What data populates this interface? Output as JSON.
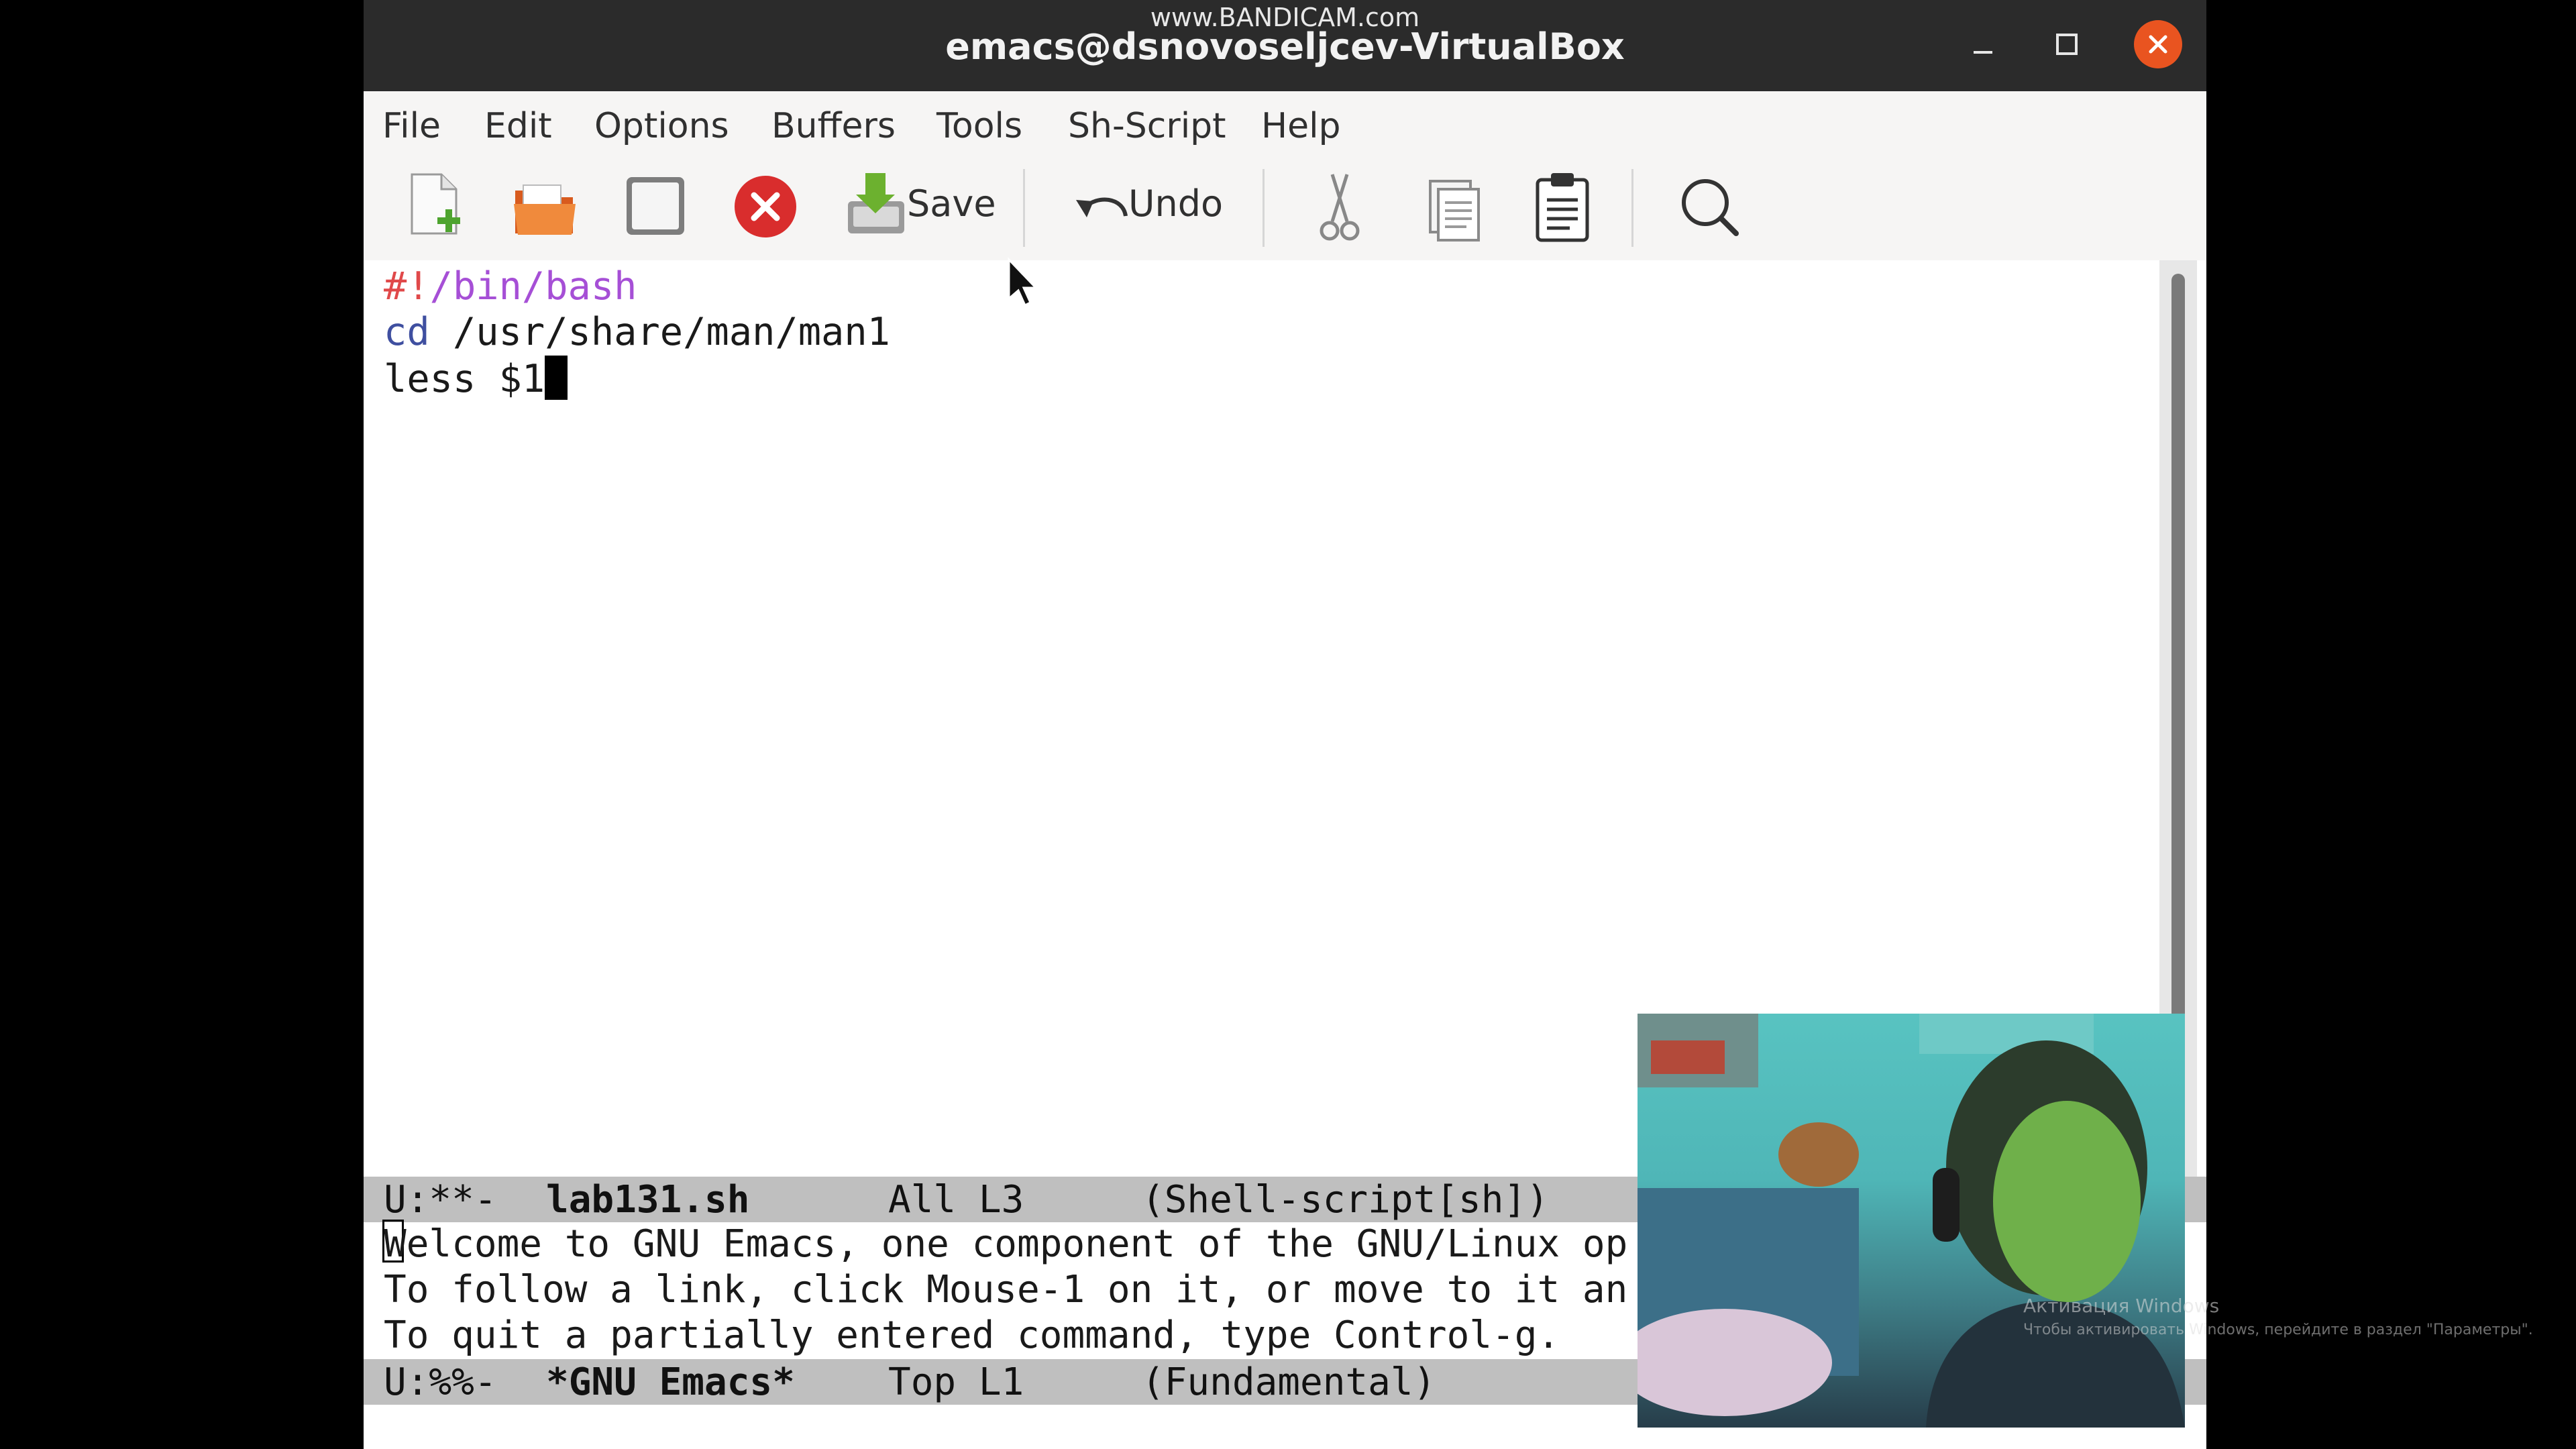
{
  "window": {
    "watermark": "www.BANDICAM.com",
    "title": "emacs@dsnovoseljcev-VirtualBox",
    "controls": {
      "minimize": "minimize-icon",
      "maximize": "maximize-icon",
      "close": "close-icon"
    }
  },
  "menubar": {
    "items": [
      {
        "label": "File"
      },
      {
        "label": "Edit"
      },
      {
        "label": "Options"
      },
      {
        "label": "Buffers"
      },
      {
        "label": "Tools"
      },
      {
        "label": "Sh-Script"
      },
      {
        "label": "Help"
      }
    ]
  },
  "toolbar": {
    "save_label": "Save",
    "undo_label": "Undo",
    "icons": [
      "new-file-icon",
      "open-folder-icon",
      "dired-icon",
      "close-buffer-icon",
      "save-icon",
      "undo-icon",
      "cut-icon",
      "copy-icon",
      "paste-icon",
      "search-icon"
    ]
  },
  "editor": {
    "lines": [
      {
        "shebang_prefix": "#!",
        "shebang_path": "/bin/bash"
      },
      {
        "keyword": "cd",
        "rest": " /usr/share/man/man1"
      },
      {
        "text": "less $1"
      }
    ]
  },
  "modeline_top": {
    "status": "U:**-",
    "buffer": "lab131.sh",
    "position": "All L3",
    "mode": "(Shell-script[sh])"
  },
  "echo_area": {
    "lines": [
      "Welcome to GNU Emacs, one component of the GNU/Linux op",
      "To follow a link, click Mouse-1 on it, or move to it an",
      "To quit a partially entered command, type Control-g."
    ]
  },
  "modeline_bottom": {
    "status": "U:%%-",
    "buffer": "*GNU Emacs*",
    "position": "Top L1",
    "mode": "(Fundamental)"
  },
  "overlay": {
    "activation_title": "Активация Windows",
    "activation_text": "Чтобы активировать Windows, перейдите в раздел \"Параметры\"."
  },
  "colors": {
    "shebang": "#e0494a",
    "path": "#a64fd6",
    "keyword": "#3f4fa0",
    "close_button": "#e95420",
    "titlebar": "#2b2b2b"
  }
}
